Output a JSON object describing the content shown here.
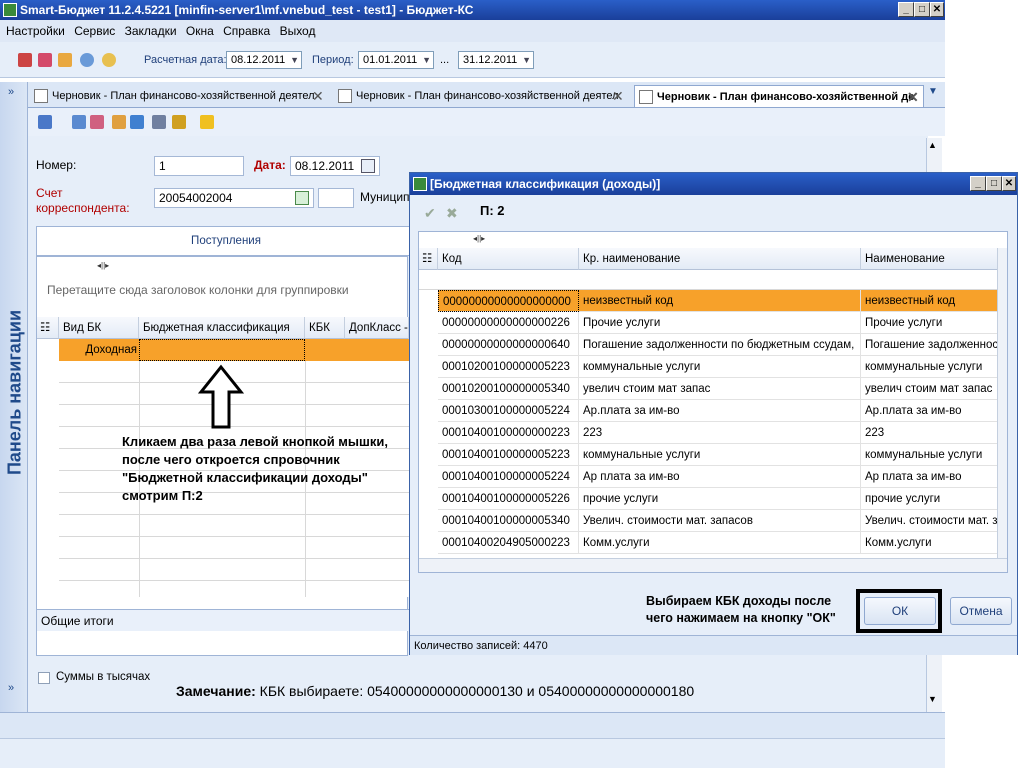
{
  "window": {
    "title": "Smart-Бюджет 11.2.4.5221 [minfin-server1\\mf.vnebud_test - test1] - Бюджет-КС"
  },
  "menu": [
    "Настройки",
    "Сервис",
    "Закладки",
    "Окна",
    "Справка",
    "Выход"
  ],
  "toolbar": {
    "calc_date_label": "Расчетная дата:",
    "calc_date_value": "08.12.2011",
    "period_label": "Период:",
    "period_from": "01.01.2011",
    "period_sep": "...",
    "period_to": "31.12.2011"
  },
  "nav_panel": {
    "label": "Панель навигации"
  },
  "tabs": [
    {
      "label": "Черновик - План финансово-хозяйственной деятел"
    },
    {
      "label": "Черновик - План финансово-хозяйственной деятел"
    },
    {
      "label": "Черновик - План финансово-хозяйственной де"
    }
  ],
  "form": {
    "number_label": "Номер:",
    "number_value": "1",
    "date_label": "Дата:",
    "date_value": "08.12.2011",
    "account_label": "Счет корреспондента:",
    "account_value": "20054002004",
    "municip_label": "Муницип",
    "tab_income": "Поступления",
    "group_hint": "Перетащите сюда заголовок колонки для группировки",
    "columns": [
      "Вид БК",
      "Бюджетная классификация",
      "КБК",
      "ДопКласс -"
    ],
    "row_type": "Доходная",
    "totals": "Общие итоги",
    "thousands_label": "Суммы в тысячах"
  },
  "annotation_left": "Кликаем два раза левой кнопкой мышки, после чего откроется спровочник \"Бюджетной классификации доходы\" смотрим П:2",
  "remark": {
    "bold": "Замечание:",
    "text": " КБК выбираете: 05400000000000000130 и 05400000000000000180"
  },
  "dialog": {
    "title": "[Бюджетная классификация (доходы)]",
    "step": "П: 2",
    "columns": [
      "Код",
      "Кр. наименование",
      "Наименование"
    ],
    "rows": [
      {
        "code": "00000000000000000000",
        "short": "неизвестный код",
        "name": "неизвестный код"
      },
      {
        "code": "00000000000000000226",
        "short": "Прочие услуги",
        "name": "Прочие услуги"
      },
      {
        "code": "00000000000000000640",
        "short": "Погашение задолженности по бюджетным ссудам,",
        "name": "Погашение задолженност"
      },
      {
        "code": "00010200100000005223",
        "short": "коммунальные услуги",
        "name": "коммунальные услуги"
      },
      {
        "code": "00010200100000005340",
        "short": "увелич стоим мат запас",
        "name": "увелич стоим мат запас"
      },
      {
        "code": "00010300100000005224",
        "short": "Ар.плата за им-во",
        "name": "Ар.плата за им-во"
      },
      {
        "code": "00010400100000000223",
        "short": "223",
        "name": "223"
      },
      {
        "code": "00010400100000005223",
        "short": "коммунальные услуги",
        "name": "коммунальные услуги"
      },
      {
        "code": "00010400100000005224",
        "short": "Ар плата за им-во",
        "name": "Ар плата за им-во"
      },
      {
        "code": "00010400100000005226",
        "short": "прочие услуги",
        "name": "прочие услуги"
      },
      {
        "code": "00010400100000005340",
        "short": "Увелич. стоимости мат. запасов",
        "name": "Увелич. стоимости мат. за"
      },
      {
        "code": "00010400204905000223",
        "short": "Комм.услуги",
        "name": "Комм.услуги"
      }
    ],
    "hint": "Выбираем КБК доходы после чего нажимаем на кнопку \"ОК\"",
    "ok": "ОК",
    "cancel": "Отмена",
    "status": "Количество записей: 4470"
  }
}
